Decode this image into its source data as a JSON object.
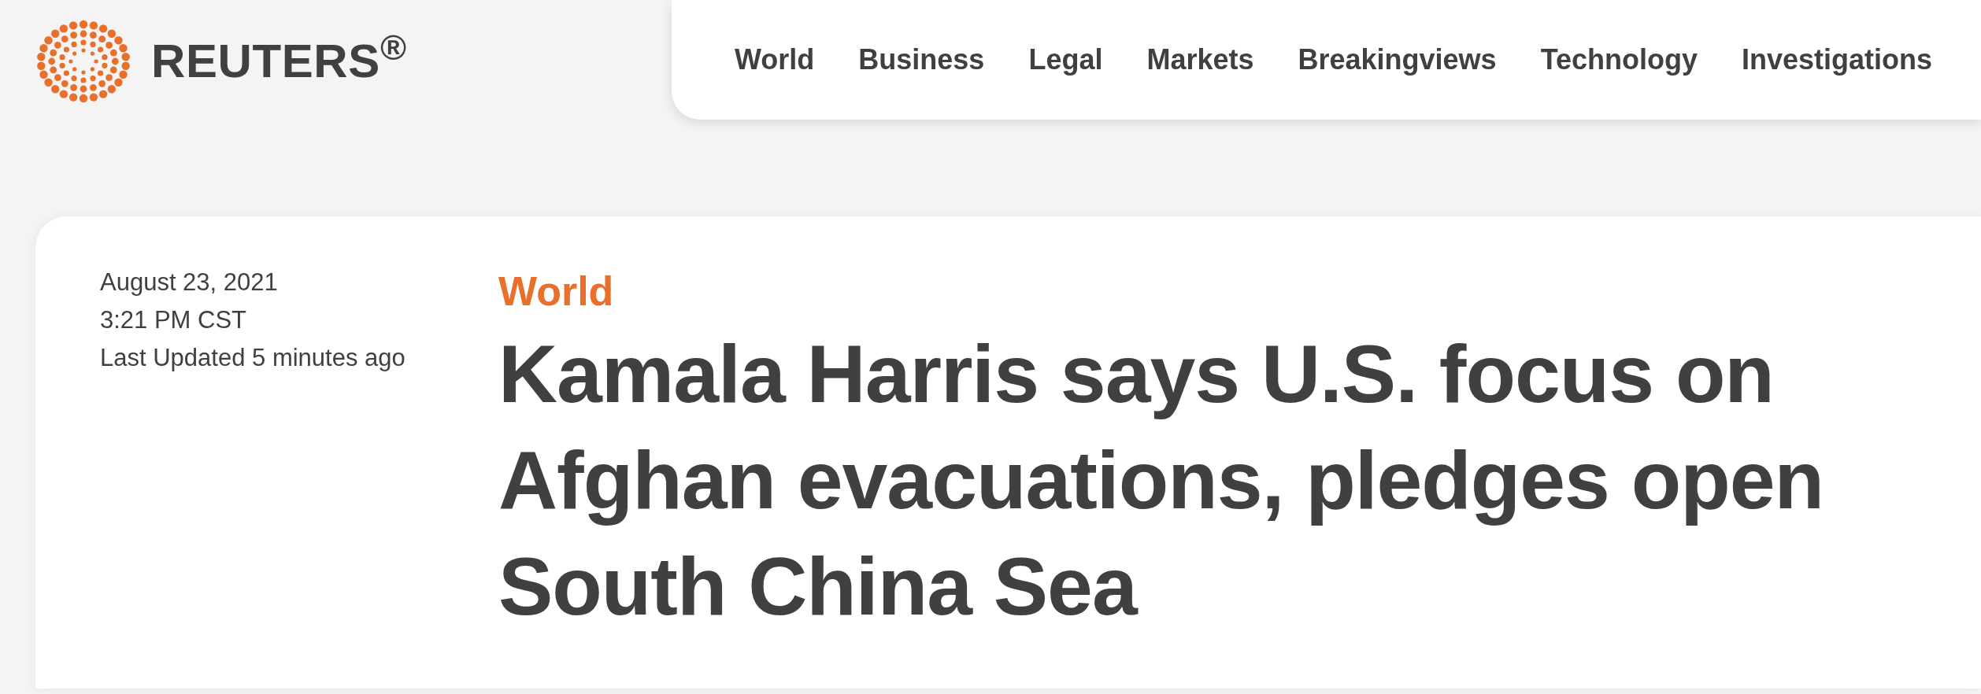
{
  "logo": {
    "text": "REUTERS$^{®}$"
  },
  "nav": {
    "items": [
      {
        "label": "World"
      },
      {
        "label": "Business"
      },
      {
        "label": "Legal"
      },
      {
        "label": "Markets"
      },
      {
        "label": "Breakingviews"
      },
      {
        "label": "Technology"
      },
      {
        "label": "Investigations"
      }
    ]
  },
  "article": {
    "dateline": [
      "August 23, 2021",
      "3:21 PM CST",
      "Last Updated 5 minutes ago"
    ],
    "section": "World",
    "headline": "Kamala Harris says U.S. focus on Afghan evacuations, pledges open South China Sea"
  }
}
